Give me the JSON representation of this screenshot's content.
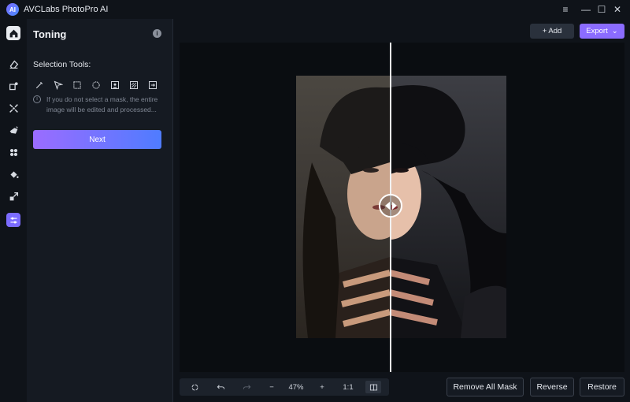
{
  "app": {
    "title": "AVCLabs PhotoPro AI",
    "logo_text": "AI"
  },
  "window_controls": {
    "menu": "≡",
    "minimize": "—",
    "maximize": "☐",
    "close": "✕"
  },
  "rail": {
    "items": [
      {
        "icon": "home-icon"
      },
      {
        "icon": "eraser-icon"
      },
      {
        "icon": "enhance-icon"
      },
      {
        "icon": "replace-icon"
      },
      {
        "icon": "cutout-icon"
      },
      {
        "icon": "colorize-icon"
      },
      {
        "icon": "fill-icon"
      },
      {
        "icon": "upscale-icon"
      },
      {
        "icon": "toning-icon",
        "active": true
      }
    ]
  },
  "panel": {
    "title": "Toning",
    "info_glyph": "i",
    "selection_label": "Selection Tools:",
    "tools": [
      "brush-icon",
      "lasso-icon",
      "rectangle-select-icon",
      "ellipse-select-icon",
      "portrait-select-icon",
      "object-select-icon",
      "import-mask-icon"
    ],
    "hint_glyph": "i",
    "hint": "If you do not select a mask, the entire image will be edited and processed...",
    "next_label": "Next"
  },
  "toolbar": {
    "add_label": "+ Add",
    "export_label": "Export",
    "export_chevron": "⌄"
  },
  "bottom": {
    "zoom_out": "−",
    "zoom_value": "47%",
    "zoom_in": "+",
    "ratio": "1:1",
    "remove_all_mask": "Remove All Mask",
    "reverse": "Reverse",
    "restore": "Restore"
  },
  "colors": {
    "accent": "#8b6cff",
    "gradient_start": "#9b6cff",
    "gradient_end": "#4f7cff",
    "background": "#0f1319",
    "panel": "#151a22"
  }
}
